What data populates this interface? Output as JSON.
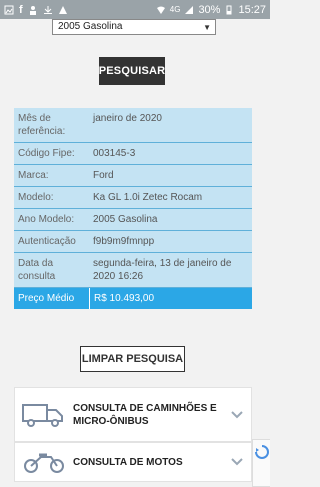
{
  "status": {
    "battery": "30%",
    "time": "15:27",
    "network": "4G"
  },
  "form": {
    "selected_year": "2005 Gasolina"
  },
  "buttons": {
    "search": "PESQUISAR",
    "clear": "LIMPAR PESQUISA"
  },
  "results": [
    {
      "label": "Mês de referência:",
      "value": "janeiro de 2020"
    },
    {
      "label": "Código Fipe:",
      "value": "003145-3"
    },
    {
      "label": "Marca:",
      "value": "Ford"
    },
    {
      "label": "Modelo:",
      "value": "Ka GL 1.0i Zetec Rocam"
    },
    {
      "label": "Ano Modelo:",
      "value": "2005 Gasolina"
    },
    {
      "label": "Autenticação",
      "value": "f9b9m9fmnpp"
    },
    {
      "label": "Data da consulta",
      "value": "segunda-feira, 13 de janeiro de 2020 16:26"
    },
    {
      "label": "Preço Médio",
      "value": "R$ 10.493,00"
    }
  ],
  "accordion": {
    "trucks": "CONSULTA DE CAMINHÕES E MICRO-ÔNIBUS",
    "motos": "CONSULTA DE MOTOS"
  },
  "colors": {
    "table_bg": "#c4e3f3",
    "table_border": "#5fb0d9",
    "price_bg": "#2ba7e6",
    "dark_button": "#333333"
  }
}
